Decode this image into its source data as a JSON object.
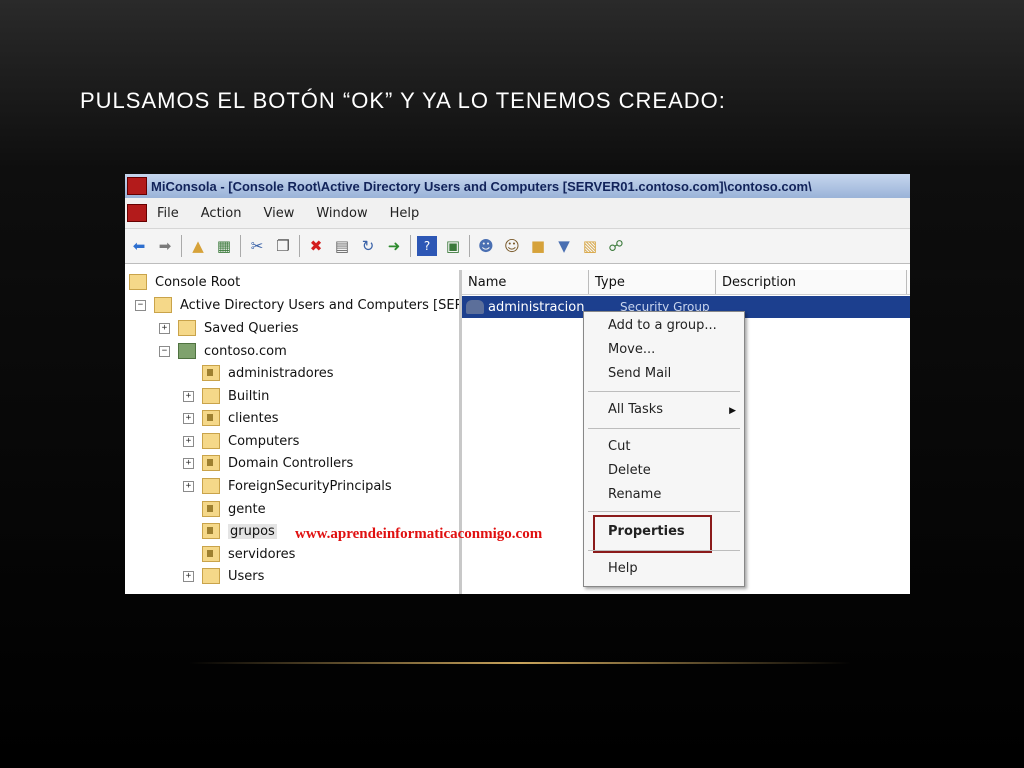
{
  "slide": {
    "title": "PULSAMOS EL BOTÓN “OK” Y YA LO TENEMOS CREADO:"
  },
  "window": {
    "title": "MiConsola - [Console Root\\Active Directory Users and Computers [SERVER01.contoso.com]\\contoso.com\\",
    "menu": [
      "File",
      "Action",
      "View",
      "Window",
      "Help"
    ]
  },
  "tree": {
    "console_root": "Console Root",
    "aduc": "Active Directory Users and Computers [SERV",
    "saved_queries": "Saved Queries",
    "domain": "contoso.com",
    "items": [
      "administradores",
      "Builtin",
      "clientes",
      "Computers",
      "Domain Controllers",
      "ForeignSecurityPrincipals",
      "gente",
      "grupos",
      "servidores",
      "Users"
    ]
  },
  "list": {
    "columns": [
      "Name",
      "Type",
      "Description"
    ],
    "selected_name": "administracion",
    "selected_type": "Security Group"
  },
  "context_menu": {
    "items": [
      "Add to a group...",
      "Move...",
      "Send Mail",
      "All Tasks",
      "Cut",
      "Delete",
      "Rename",
      "Properties",
      "Help"
    ]
  },
  "watermark": "www.aprendeinformaticaconmigo.com",
  "colors": {
    "selection": "#1c3f8e",
    "highlight_box": "#8b1a1a",
    "watermark": "#e01010"
  }
}
